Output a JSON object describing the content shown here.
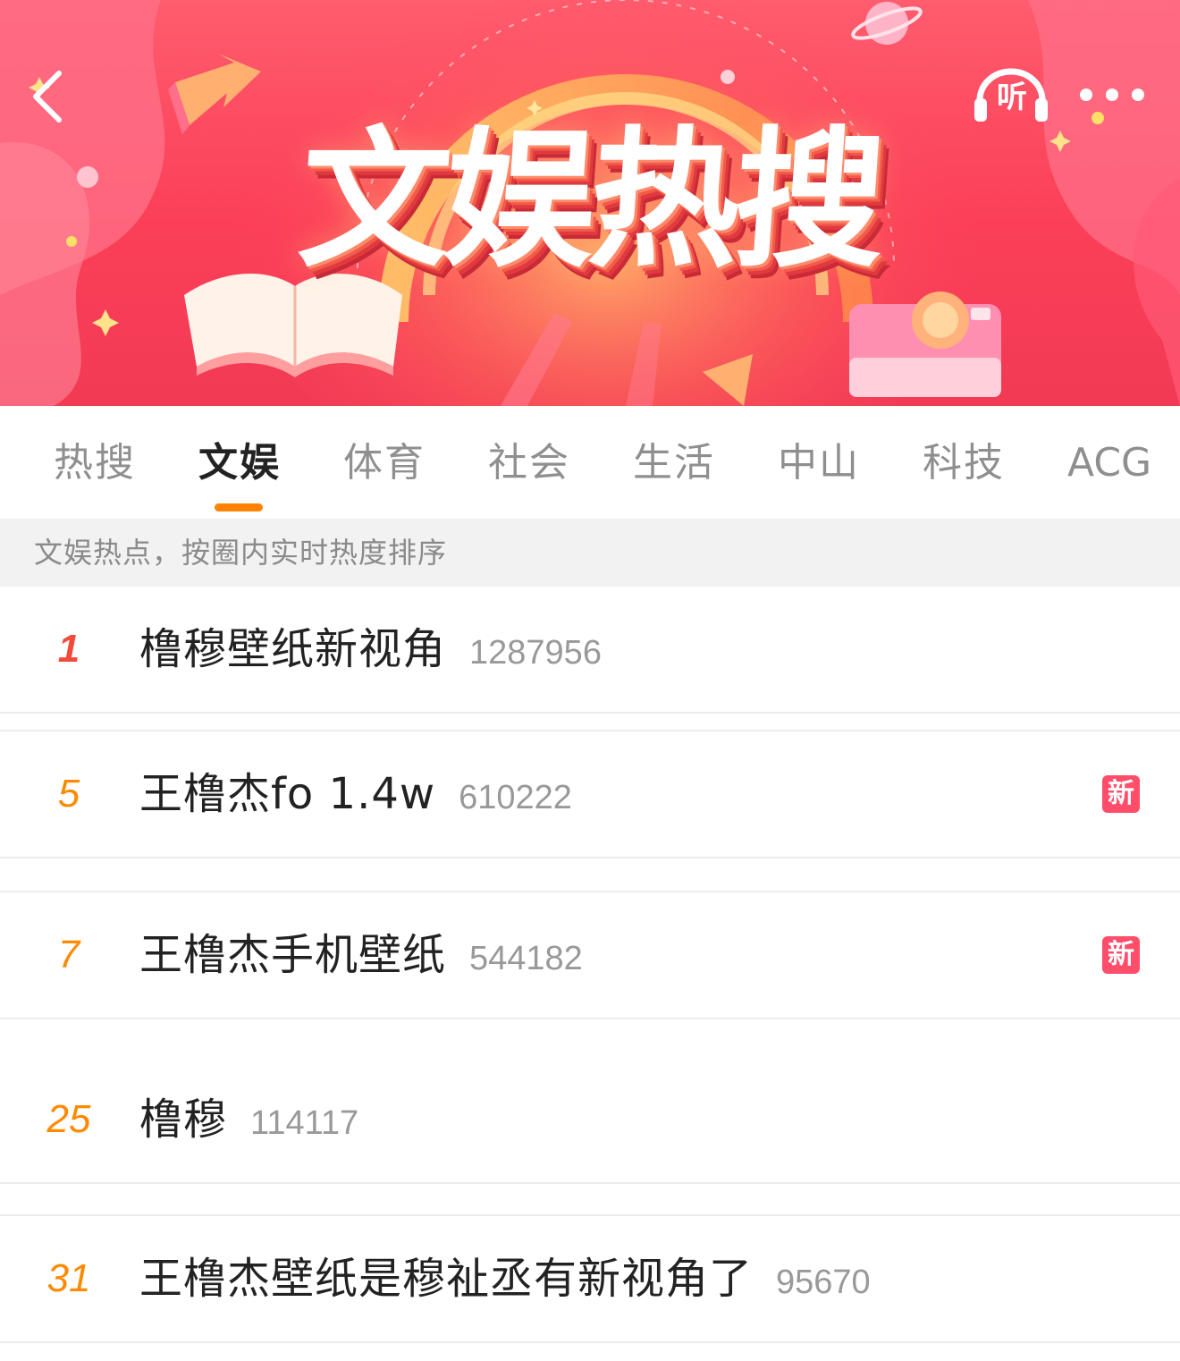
{
  "banner": {
    "title": "文娱热搜",
    "listen_label": "听"
  },
  "icons": {
    "back": "chevron-left-icon",
    "listen": "headphones-icon",
    "more": "more-dots-icon"
  },
  "colors": {
    "banner_bg": "#fb3f58",
    "tab_accent": "#ff8200",
    "rank_first": "#f24a3b",
    "rank_other": "#ff8a00",
    "badge_bg": "#ff4d6a"
  },
  "tabs": [
    {
      "label": "热搜"
    },
    {
      "label": "文娱",
      "active": true
    },
    {
      "label": "体育"
    },
    {
      "label": "社会"
    },
    {
      "label": "生活"
    },
    {
      "label": "中山"
    },
    {
      "label": "科技"
    },
    {
      "label": "ACG"
    }
  ],
  "subheader": "文娱热点，按圈内实时热度排序",
  "items": [
    {
      "rank": "1",
      "title": "橹穆壁纸新视角",
      "count": "1287956",
      "badge": ""
    },
    {
      "rank": "5",
      "title": "王橹杰fo 1.4w",
      "count": "610222",
      "badge": "新"
    },
    {
      "rank": "7",
      "title": "王橹杰手机壁纸",
      "count": "544182",
      "badge": "新"
    },
    {
      "rank": "25",
      "title": "橹穆",
      "count": "114117",
      "badge": ""
    },
    {
      "rank": "31",
      "title": "王橹杰壁纸是穆祉丞有新视角了",
      "count": "95670",
      "badge": ""
    }
  ]
}
